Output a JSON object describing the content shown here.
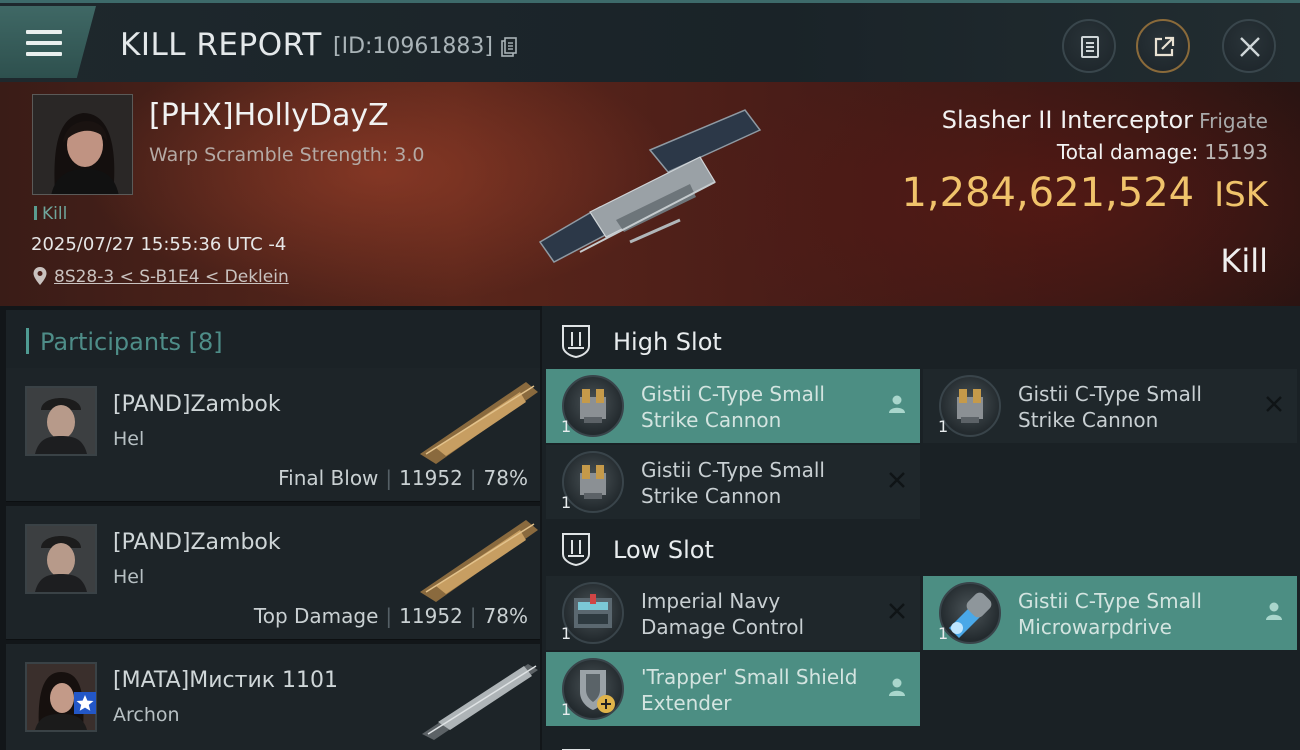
{
  "header": {
    "title": "KILL REPORT",
    "report_id": "[ID:10961883]",
    "buttons": [
      {
        "name": "clipboard-icon"
      },
      {
        "name": "share-icon"
      },
      {
        "name": "close-icon"
      }
    ]
  },
  "victim": {
    "name": "[PHX]HollyDayZ",
    "warp_scramble": "Warp Scramble Strength: 3.0",
    "kill_tag": "Kill",
    "datetime": "2025/07/27 15:55:36 UTC -4",
    "location": "8S28-3 < S-B1E4 < Deklein",
    "ship_name": "Slasher II Interceptor",
    "ship_class": "Frigate",
    "damage_label": "Total damage:",
    "damage_value": "15193",
    "isk_value": "1,284,621,524",
    "isk_unit": "ISK",
    "result": "Kill"
  },
  "participants": {
    "label": "Participants",
    "count": "[8]",
    "rows": [
      {
        "name": "[PAND]Zambok",
        "ship": "Hel",
        "role": "Final Blow",
        "damage": "11952",
        "percent": "78%"
      },
      {
        "name": "[PAND]Zambok",
        "ship": "Hel",
        "role": "Top Damage",
        "damage": "11952",
        "percent": "78%"
      },
      {
        "name": "[MATA]Мистик 1101",
        "ship": "Archon"
      }
    ]
  },
  "fitting": {
    "high_slot_label": "High Slot",
    "low_slot_label": "Low Slot",
    "high": [
      {
        "line1": "Gistii C-Type Small",
        "line2": "Strike Cannon",
        "qty": "1",
        "status": "fitted"
      },
      {
        "line1": "Gistii C-Type Small",
        "line2": "Strike Cannon",
        "qty": "1",
        "status": "destroyed"
      },
      {
        "line1": "Gistii C-Type Small",
        "line2": "Strike Cannon",
        "qty": "1",
        "status": "destroyed"
      }
    ],
    "low": [
      {
        "line1": "Imperial Navy",
        "line2": "Damage Control",
        "qty": "1",
        "status": "destroyed"
      },
      {
        "line1": "Gistii C-Type Small",
        "line2": "Microwarpdrive",
        "qty": "1",
        "status": "fitted"
      },
      {
        "line1": "'Trapper' Small Shield",
        "line2": "Extender",
        "qty": "1",
        "status": "fitted"
      }
    ]
  },
  "colors": {
    "accent_teal": "#4c8e83",
    "isk_gold": "#f0c36b",
    "hero_red": "#5a261b"
  }
}
